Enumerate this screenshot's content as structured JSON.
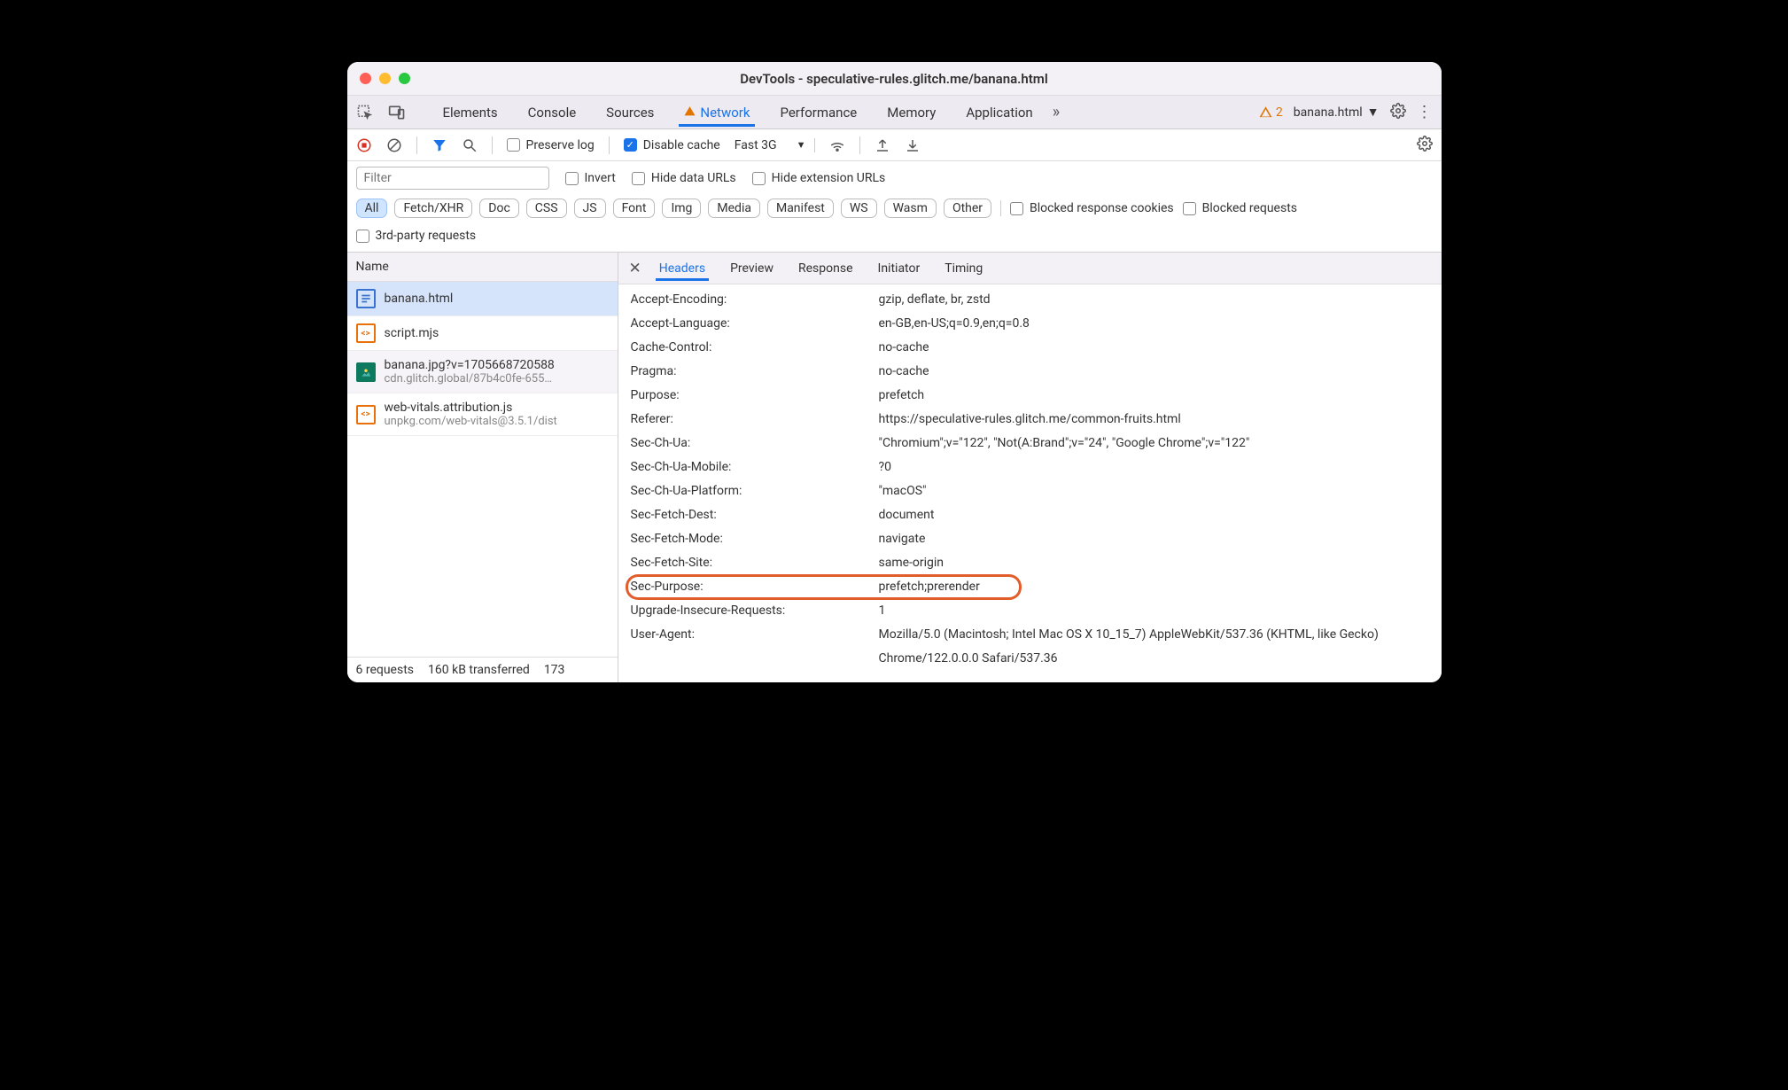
{
  "window_title": "DevTools - speculative-rules.glitch.me/banana.html",
  "main_tabs": [
    "Elements",
    "Console",
    "Sources",
    "Network",
    "Performance",
    "Memory",
    "Application"
  ],
  "active_main_tab": "Network",
  "warning_count": "2",
  "context_selector": "banana.html",
  "toolbar": {
    "preserve_log": "Preserve log",
    "disable_cache": "Disable cache",
    "throttle": "Fast 3G"
  },
  "filter_placeholder": "Filter",
  "filter_checks": {
    "invert": "Invert",
    "hide_data_urls": "Hide data URLs",
    "hide_ext_urls": "Hide extension URLs"
  },
  "type_pills": [
    "All",
    "Fetch/XHR",
    "Doc",
    "CSS",
    "JS",
    "Font",
    "Img",
    "Media",
    "Manifest",
    "WS",
    "Wasm",
    "Other"
  ],
  "extra_checks": {
    "blocked_cookies": "Blocked response cookies",
    "blocked_requests": "Blocked requests",
    "third_party": "3rd-party requests"
  },
  "name_header": "Name",
  "requests": [
    {
      "name": "banana.html",
      "sub": "",
      "icon": "doc",
      "selected": true
    },
    {
      "name": "script.mjs",
      "sub": "",
      "icon": "js",
      "selected": false
    },
    {
      "name": "banana.jpg?v=1705668720588",
      "sub": "cdn.glitch.global/87b4c0fe-655…",
      "icon": "img",
      "selected": false
    },
    {
      "name": "web-vitals.attribution.js",
      "sub": "unpkg.com/web-vitals@3.5.1/dist",
      "icon": "js",
      "selected": false
    }
  ],
  "status": {
    "requests": "6 requests",
    "transferred": "160 kB transferred",
    "resources": "173"
  },
  "detail_tabs": [
    "Headers",
    "Preview",
    "Response",
    "Initiator",
    "Timing"
  ],
  "active_detail_tab": "Headers",
  "headers": [
    {
      "k": "Accept-Encoding:",
      "v": "gzip, deflate, br, zstd"
    },
    {
      "k": "Accept-Language:",
      "v": "en-GB,en-US;q=0.9,en;q=0.8"
    },
    {
      "k": "Cache-Control:",
      "v": "no-cache"
    },
    {
      "k": "Pragma:",
      "v": "no-cache"
    },
    {
      "k": "Purpose:",
      "v": "prefetch"
    },
    {
      "k": "Referer:",
      "v": "https://speculative-rules.glitch.me/common-fruits.html"
    },
    {
      "k": "Sec-Ch-Ua:",
      "v": "\"Chromium\";v=\"122\", \"Not(A:Brand\";v=\"24\", \"Google Chrome\";v=\"122\""
    },
    {
      "k": "Sec-Ch-Ua-Mobile:",
      "v": "?0"
    },
    {
      "k": "Sec-Ch-Ua-Platform:",
      "v": "\"macOS\""
    },
    {
      "k": "Sec-Fetch-Dest:",
      "v": "document"
    },
    {
      "k": "Sec-Fetch-Mode:",
      "v": "navigate"
    },
    {
      "k": "Sec-Fetch-Site:",
      "v": "same-origin"
    },
    {
      "k": "Sec-Purpose:",
      "v": "prefetch;prerender",
      "highlight": true
    },
    {
      "k": "Upgrade-Insecure-Requests:",
      "v": "1"
    },
    {
      "k": "User-Agent:",
      "v": "Mozilla/5.0 (Macintosh; Intel Mac OS X 10_15_7) AppleWebKit/537.36 (KHTML, like Gecko) Chrome/122.0.0.0 Safari/537.36"
    }
  ]
}
